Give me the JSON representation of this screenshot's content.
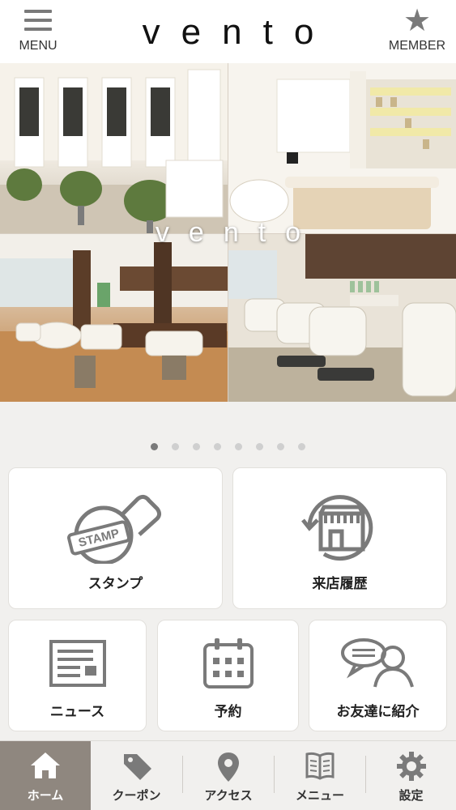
{
  "header": {
    "menu_label": "MENU",
    "logo_text": "vento",
    "member_label": "MEMBER"
  },
  "hero": {
    "overlay_logo": "vento",
    "slide_count": 8,
    "active_slide": 1
  },
  "tiles": {
    "stamp": {
      "label": "スタンプ",
      "badge_text": "STAMP",
      "icon": "stamp-icon"
    },
    "visit_history": {
      "label": "来店履歴",
      "icon": "storefront-history-icon"
    },
    "news": {
      "label": "ニュース",
      "icon": "newspaper-icon"
    },
    "reservation": {
      "label": "予約",
      "icon": "calendar-icon"
    },
    "referral": {
      "label": "お友達に紹介",
      "icon": "person-chat-icon"
    }
  },
  "tabbar": {
    "items": [
      {
        "label": "ホーム",
        "icon": "home-icon",
        "active": true
      },
      {
        "label": "クーポン",
        "icon": "tag-icon",
        "active": false
      },
      {
        "label": "アクセス",
        "icon": "map-pin-icon",
        "active": false
      },
      {
        "label": "メニュー",
        "icon": "book-icon",
        "active": false
      },
      {
        "label": "設定",
        "icon": "gear-icon",
        "active": false
      }
    ]
  },
  "colors": {
    "icon_gray": "#7a7a7a",
    "tab_active_bg": "#8f877f",
    "page_bg": "#f1f0ee"
  }
}
